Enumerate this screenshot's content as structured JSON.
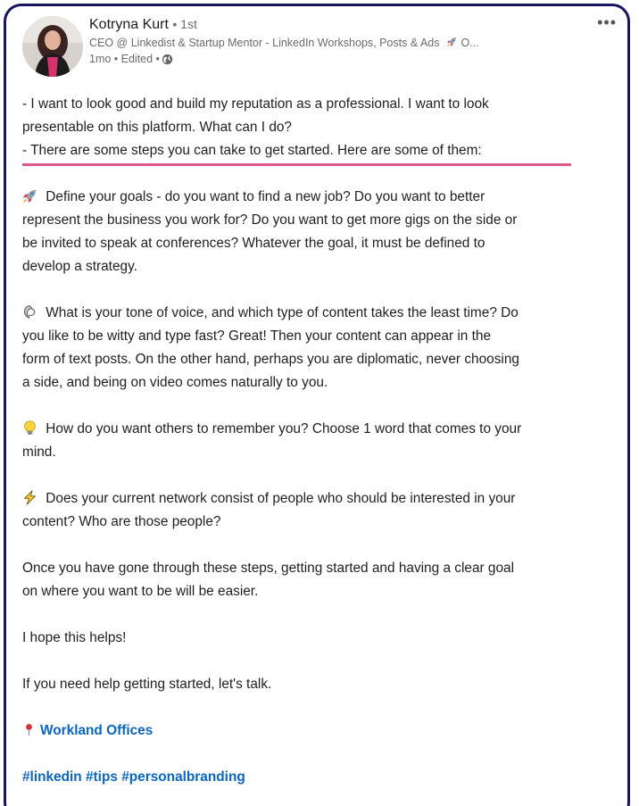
{
  "post": {
    "author": {
      "name": "Kotryna Kurt",
      "degree": "• 1st",
      "headline": "CEO @ Linkedist & Startup Mentor - LinkedIn Workshops, Posts & Ads",
      "headline_suffix": " O...",
      "meta": "1mo • Edited •"
    },
    "more_label": "•••",
    "lines": {
      "intro1": "- I want to look good and build my reputation as a professional. I want to look",
      "intro2": "presentable on this platform. What can I do?",
      "intro3": "- There are some steps you can take to get started. Here are some of them:",
      "goals1": " Define your goals - do you want to find a new job? Do you want to better",
      "goals2": "represent the business you work for? Do you want to get more gigs on the side or",
      "goals3": "be invited to speak at conferences? Whatever the goal, it must be defined to",
      "goals4": "develop a strategy.",
      "tone1": " What is your tone of voice, and which type of content takes the least time? Do",
      "tone2": "you like to be witty and type fast? Great! Then your content can appear in the",
      "tone3": "form of text posts. On the other hand, perhaps you are diplomatic, never choosing",
      "tone4": "a side, and being on video comes naturally to you.",
      "remember1": " How do you want others to remember you? Choose 1 word that comes to your",
      "remember2": "mind.",
      "network1": " Does your current network consist of people who should be interested in your",
      "network2": "content? Who are those people?",
      "steps1": "Once you have gone through these steps, getting started and having a clear goal",
      "steps2": "on where you want to be will be easier.",
      "hope": "I hope this helps!",
      "talk": "If you need help getting started, let's talk.",
      "location": "Workland Offices",
      "hashtags": [
        "#linkedin",
        "#tips",
        "#personalbranding"
      ]
    },
    "icons": {
      "rocket": "rocket-icon",
      "speech": "speech-bubble-icon",
      "bulb": "lightbulb-icon",
      "bolt": "lightning-icon",
      "pin": "pin-icon",
      "globe": "globe-icon"
    },
    "colors": {
      "frame": "#18155f",
      "underline": "#e0558a",
      "link": "#0a66c2"
    }
  }
}
